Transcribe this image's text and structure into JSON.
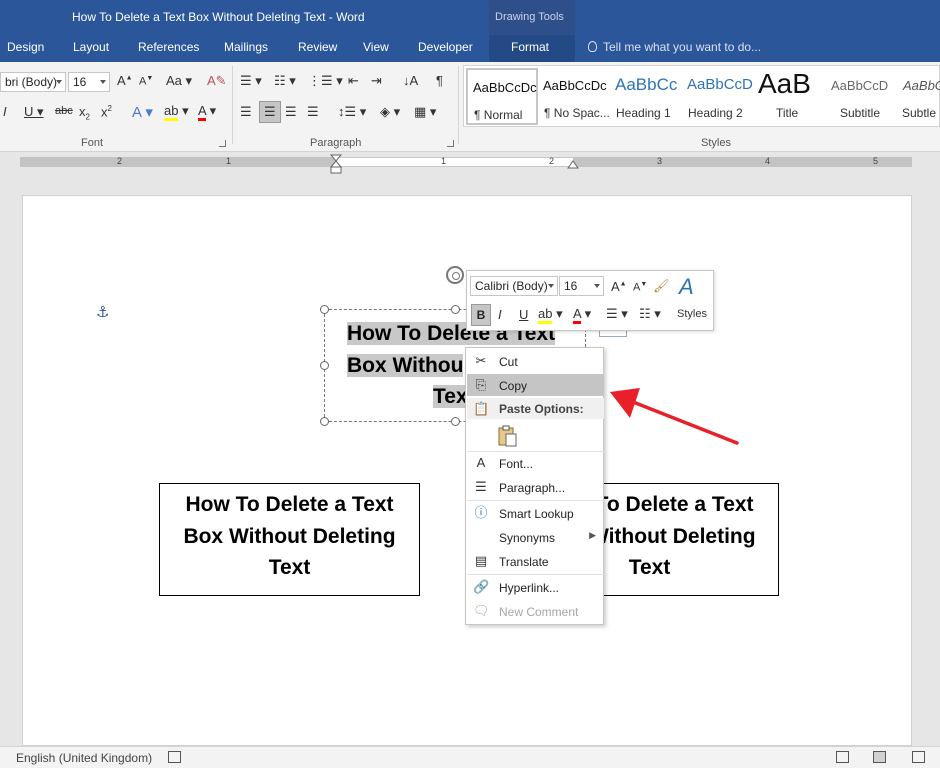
{
  "window": {
    "title": "How To Delete a Text Box Without Deleting Text - Word",
    "contextual_tab_group": "Drawing Tools"
  },
  "tabs": [
    "Design",
    "Layout",
    "References",
    "Mailings",
    "Review",
    "View",
    "Developer"
  ],
  "active_tab": "Format",
  "tell_me": "Tell me what you want to do...",
  "ribbon": {
    "font_name": "bri (Body)",
    "font_size": "16",
    "group_font": "Font",
    "group_paragraph": "Paragraph",
    "group_styles": "Styles",
    "styles": [
      {
        "preview": "AaBbCcDc",
        "name": "¶ Normal"
      },
      {
        "preview": "AaBbCcDc",
        "name": "¶ No Spac..."
      },
      {
        "preview": "AaBbCc",
        "name": "Heading 1"
      },
      {
        "preview": "AaBbCcD",
        "name": "Heading 2"
      },
      {
        "preview": "AaB",
        "name": "Title"
      },
      {
        "preview": "AaBbCcD",
        "name": "Subtitle"
      },
      {
        "preview": "AaBbCcL",
        "name": "Subtle E"
      }
    ]
  },
  "ruler": {
    "labels": [
      "2",
      "1",
      "1",
      "2",
      "3",
      "4",
      "5"
    ]
  },
  "document": {
    "textbox_selected_line1": "How To Delete a Text",
    "textbox_selected_line2": "Box Withou",
    "textbox_selected_line3": "Tex",
    "textbox_left_line1": "How To Delete a Text",
    "textbox_left_line2": "Box Without Deleting",
    "textbox_left_line3": "Text",
    "textbox_right_line1": "How To Delete a Text",
    "textbox_right_line2": "Box Without Deleting",
    "textbox_right_line3": "Text"
  },
  "minitoolbar": {
    "font_name": "Calibri (Body)",
    "font_size": "16",
    "styles_label": "Styles"
  },
  "context_menu": {
    "cut": "Cut",
    "copy": "Copy",
    "paste_options": "Paste Options:",
    "font": "Font...",
    "paragraph": "Paragraph...",
    "smart_lookup": "Smart Lookup",
    "synonyms": "Synonyms",
    "translate": "Translate",
    "hyperlink": "Hyperlink...",
    "new_comment": "New Comment"
  },
  "statusbar": {
    "language": "English (United Kingdom)"
  },
  "colors": {
    "title_bar": "#2b579a",
    "highlight_yellow": "#ffff00",
    "font_red": "#ff0000",
    "arrow_red": "#e8202a"
  }
}
